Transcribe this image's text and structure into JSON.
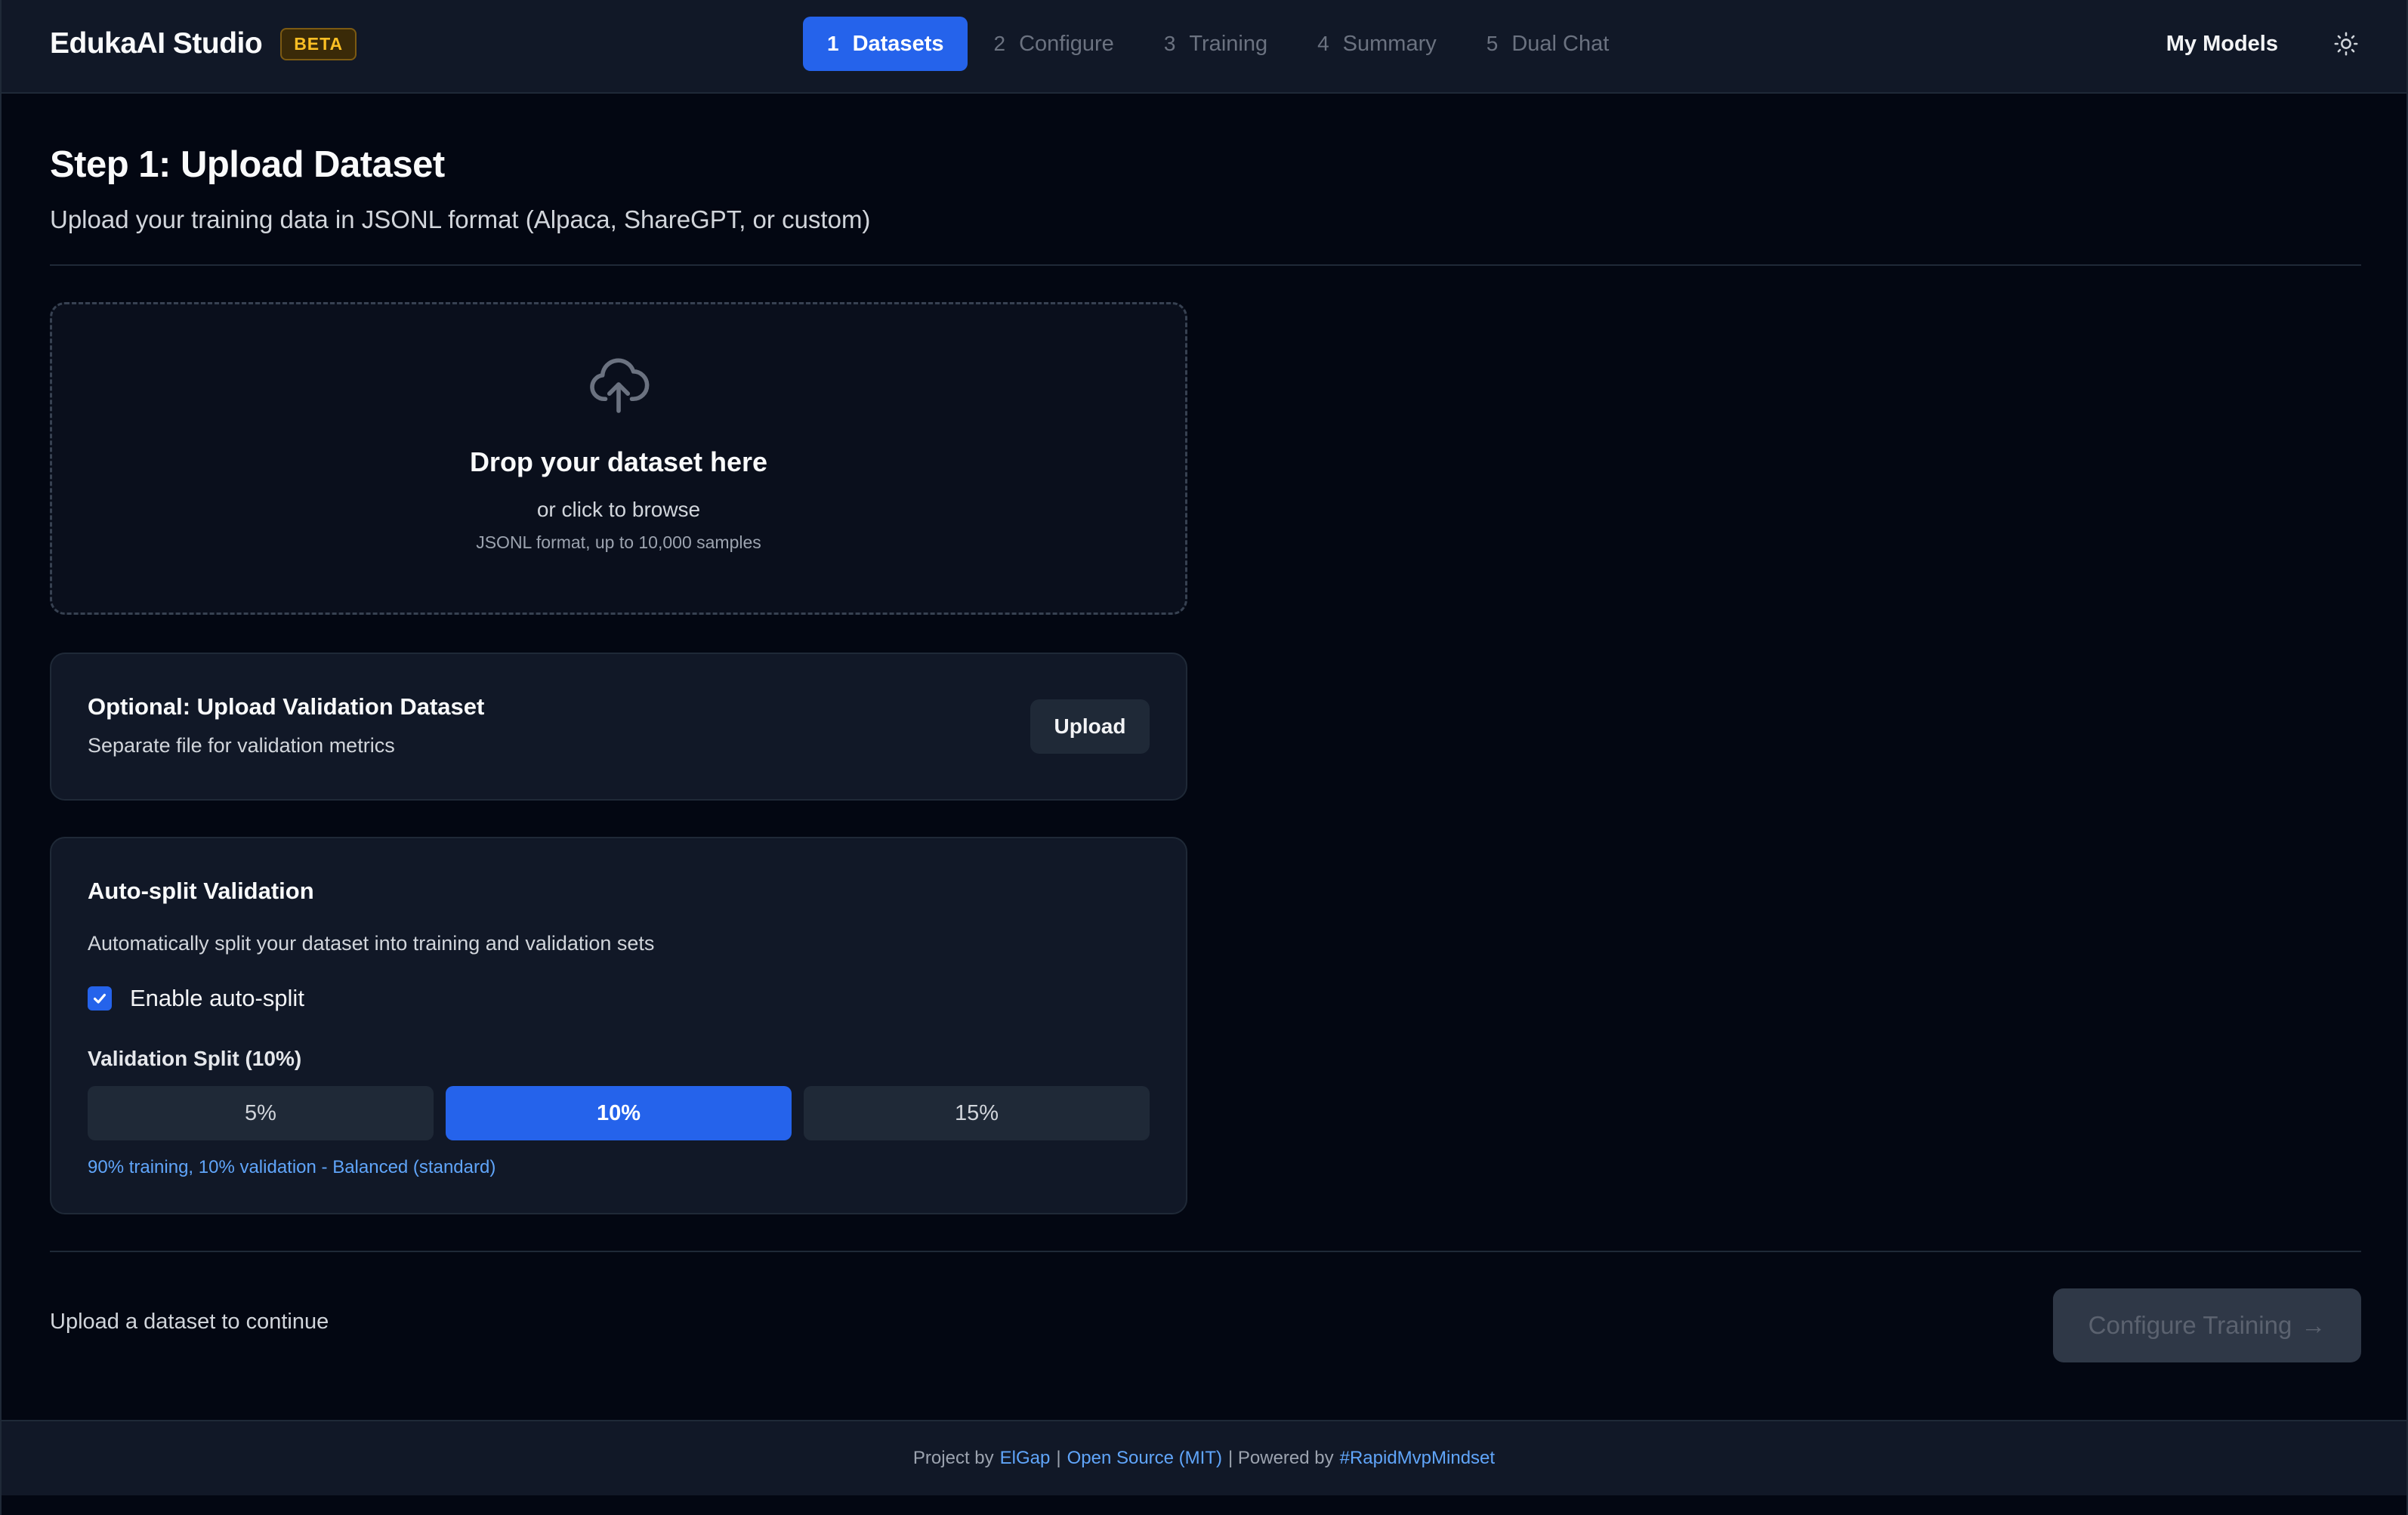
{
  "header": {
    "brand": "EdukaAI Studio",
    "badge": "BETA",
    "steps": [
      {
        "num": "1",
        "label": "Datasets"
      },
      {
        "num": "2",
        "label": "Configure"
      },
      {
        "num": "3",
        "label": "Training"
      },
      {
        "num": "4",
        "label": "Summary"
      },
      {
        "num": "5",
        "label": "Dual Chat"
      }
    ],
    "active_step": 0,
    "my_models": "My Models",
    "theme_icon": "sun-icon"
  },
  "main": {
    "title": "Step 1: Upload Dataset",
    "subtitle": "Upload your training data in JSONL format (Alpaca, ShareGPT, or custom)",
    "dropzone": {
      "icon": "cloud-upload-icon",
      "title": "Drop your dataset here",
      "sub": "or click to browse",
      "hint": "JSONL format, up to 10,000 samples"
    },
    "validation_upload": {
      "title": "Optional: Upload Validation Dataset",
      "sub": "Separate file for validation metrics",
      "button": "Upload"
    },
    "auto_split": {
      "title": "Auto-split Validation",
      "description": "Automatically split your dataset into training and validation sets",
      "checkbox_label": "Enable auto-split",
      "checked": true,
      "split_label": "Validation Split (10%)",
      "options": [
        "5%",
        "10%",
        "15%"
      ],
      "selected_option": 1,
      "note": "90% training, 10% validation - Balanced (standard)"
    },
    "continue_text": "Upload a dataset to continue",
    "configure_button": "Configure Training",
    "configure_button_arrow": "→"
  },
  "footer": {
    "prefix": "Project by",
    "author": "ElGap",
    "sep1": "|",
    "license": "Open Source (MIT)",
    "sep2": "| Powered by",
    "tag": "#RapidMvpMindset"
  },
  "colors": {
    "accent": "#2563eb",
    "background": "#030712",
    "surface": "#111827",
    "link": "#60a5fa",
    "badge": "#fbbf24"
  }
}
